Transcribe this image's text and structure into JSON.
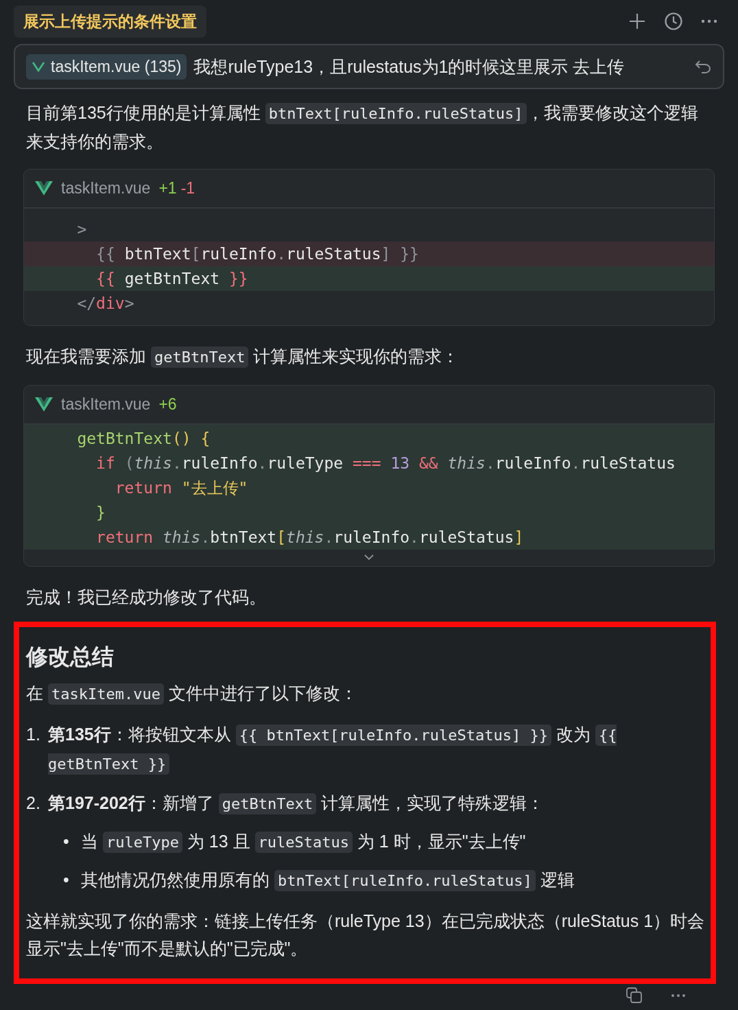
{
  "header": {
    "title": "展示上传提示的条件设置"
  },
  "prompt": {
    "file_chip": "taskItem.vue (135)",
    "text": "我想ruleType13，且rulestatus为1的时候这里展示 去上传"
  },
  "content": [
    {
      "kind": "paragraph",
      "segments": [
        {
          "kind": "text",
          "text": "目前第135行使用的是计算属性 "
        },
        {
          "kind": "code",
          "text": "btnText[ruleInfo.ruleStatus]"
        },
        {
          "kind": "text",
          "text": "，我需要修改这个逻辑来支持你的需求。"
        }
      ]
    },
    {
      "kind": "code_block",
      "file": "taskItem.vue",
      "added": "+1",
      "removed": "-1",
      "expandable": false,
      "lines": [
        {
          "kind": "context",
          "tokens": [
            {
              "kind": "punct",
              "text": "    >"
            }
          ]
        },
        {
          "kind": "removed",
          "tokens": [
            {
              "kind": "punct",
              "text": "      {{"
            },
            {
              "kind": "plain",
              "text": " btnText"
            },
            {
              "kind": "punct",
              "text": "["
            },
            {
              "kind": "plain",
              "text": "ruleInfo"
            },
            {
              "kind": "punct",
              "text": "."
            },
            {
              "kind": "plain",
              "text": "ruleStatus"
            },
            {
              "kind": "punct",
              "text": "] }}"
            }
          ]
        },
        {
          "kind": "added",
          "tokens": [
            {
              "kind": "kw",
              "text": "      {{"
            },
            {
              "kind": "plain",
              "text": " getBtnText "
            },
            {
              "kind": "kw",
              "text": "}}"
            }
          ]
        },
        {
          "kind": "context",
          "tokens": [
            {
              "kind": "punct",
              "text": "    </"
            },
            {
              "kind": "kw",
              "text": "div"
            },
            {
              "kind": "punct",
              "text": ">"
            }
          ]
        }
      ]
    },
    {
      "kind": "paragraph",
      "segments": [
        {
          "kind": "text",
          "text": "现在我需要添加 "
        },
        {
          "kind": "code",
          "text": "getBtnText"
        },
        {
          "kind": "text",
          "text": " 计算属性来实现你的需求："
        }
      ]
    },
    {
      "kind": "code_block",
      "file": "taskItem.vue",
      "added": "+6",
      "expandable": true,
      "lines": [
        {
          "kind": "added",
          "tokens": [
            {
              "kind": "fn",
              "text": "    getBtnText"
            },
            {
              "kind": "brace",
              "text": "() {"
            }
          ]
        },
        {
          "kind": "added",
          "tokens": [
            {
              "kind": "kw",
              "text": "      if"
            },
            {
              "kind": "punct",
              "text": " ("
            },
            {
              "kind": "this",
              "text": "this"
            },
            {
              "kind": "punct",
              "text": "."
            },
            {
              "kind": "plain",
              "text": "ruleInfo"
            },
            {
              "kind": "punct",
              "text": "."
            },
            {
              "kind": "plain",
              "text": "ruleType "
            },
            {
              "kind": "kw",
              "text": "==="
            },
            {
              "kind": "num",
              "text": " 13 "
            },
            {
              "kind": "kw",
              "text": "&&"
            },
            {
              "kind": "this",
              "text": " this"
            },
            {
              "kind": "punct",
              "text": "."
            },
            {
              "kind": "plain",
              "text": "ruleInfo"
            },
            {
              "kind": "punct",
              "text": "."
            },
            {
              "kind": "plain",
              "text": "ruleStatus"
            }
          ]
        },
        {
          "kind": "added",
          "tokens": [
            {
              "kind": "kw",
              "text": "        return"
            },
            {
              "kind": "str",
              "text": " \"去上传\""
            }
          ]
        },
        {
          "kind": "added",
          "tokens": [
            {
              "kind": "fn",
              "text": "      }"
            }
          ]
        },
        {
          "kind": "added",
          "tokens": [
            {
              "kind": "kw",
              "text": "      return"
            },
            {
              "kind": "this",
              "text": " this"
            },
            {
              "kind": "punct",
              "text": "."
            },
            {
              "kind": "plain",
              "text": "btnText"
            },
            {
              "kind": "brace",
              "text": "["
            },
            {
              "kind": "this",
              "text": "this"
            },
            {
              "kind": "punct",
              "text": "."
            },
            {
              "kind": "plain",
              "text": "ruleInfo"
            },
            {
              "kind": "punct",
              "text": "."
            },
            {
              "kind": "plain",
              "text": "ruleStatus"
            },
            {
              "kind": "brace",
              "text": "]"
            }
          ]
        }
      ]
    },
    {
      "kind": "paragraph",
      "segments": [
        {
          "kind": "text",
          "text": "完成！我已经成功修改了代码。"
        }
      ]
    },
    {
      "kind": "summary",
      "highlighted": true,
      "heading": "修改总结",
      "blocks": [
        {
          "kind": "paragraph",
          "segments": [
            {
              "kind": "text",
              "text": "在 "
            },
            {
              "kind": "code",
              "text": "taskItem.vue"
            },
            {
              "kind": "text",
              "text": " 文件中进行了以下修改："
            }
          ]
        },
        {
          "kind": "list",
          "items": [
            {
              "marker": "1.",
              "segments": [
                {
                  "kind": "text",
                  "text": "**第135行**：将按钮文本从 "
                },
                {
                  "kind": "code",
                  "text": "{{ btnText[ruleInfo.ruleStatus] }}"
                },
                {
                  "kind": "text",
                  "text": " 改为 "
                },
                {
                  "kind": "code",
                  "text": "{{ getBtnText }}"
                }
              ]
            },
            {
              "marker": "2.",
              "segments": [
                {
                  "kind": "text",
                  "text": "**第197-202行**：新增了 "
                },
                {
                  "kind": "code",
                  "text": "getBtnText"
                },
                {
                  "kind": "text",
                  "text": " 计算属性，实现了特殊逻辑："
                }
              ],
              "children": [
                {
                  "marker": "•",
                  "segments": [
                    {
                      "kind": "text",
                      "text": "当 "
                    },
                    {
                      "kind": "code",
                      "text": "ruleType"
                    },
                    {
                      "kind": "text",
                      "text": " 为 13 且 "
                    },
                    {
                      "kind": "code",
                      "text": "ruleStatus"
                    },
                    {
                      "kind": "text",
                      "text": " 为 1 时，显示\"去上传\""
                    }
                  ]
                },
                {
                  "marker": "•",
                  "segments": [
                    {
                      "kind": "text",
                      "text": "其他情况仍然使用原有的 "
                    },
                    {
                      "kind": "code",
                      "text": "btnText[ruleInfo.ruleStatus]"
                    },
                    {
                      "kind": "text",
                      "text": " 逻辑"
                    }
                  ]
                }
              ]
            }
          ]
        },
        {
          "kind": "paragraph",
          "segments": [
            {
              "kind": "text",
              "text": "这样就实现了你的需求：链接上传任务（ruleType 13）在已完成状态（ruleStatus 1）时会显示\"去上传\"而不是默认的\"已完成\"。"
            }
          ]
        }
      ]
    }
  ]
}
